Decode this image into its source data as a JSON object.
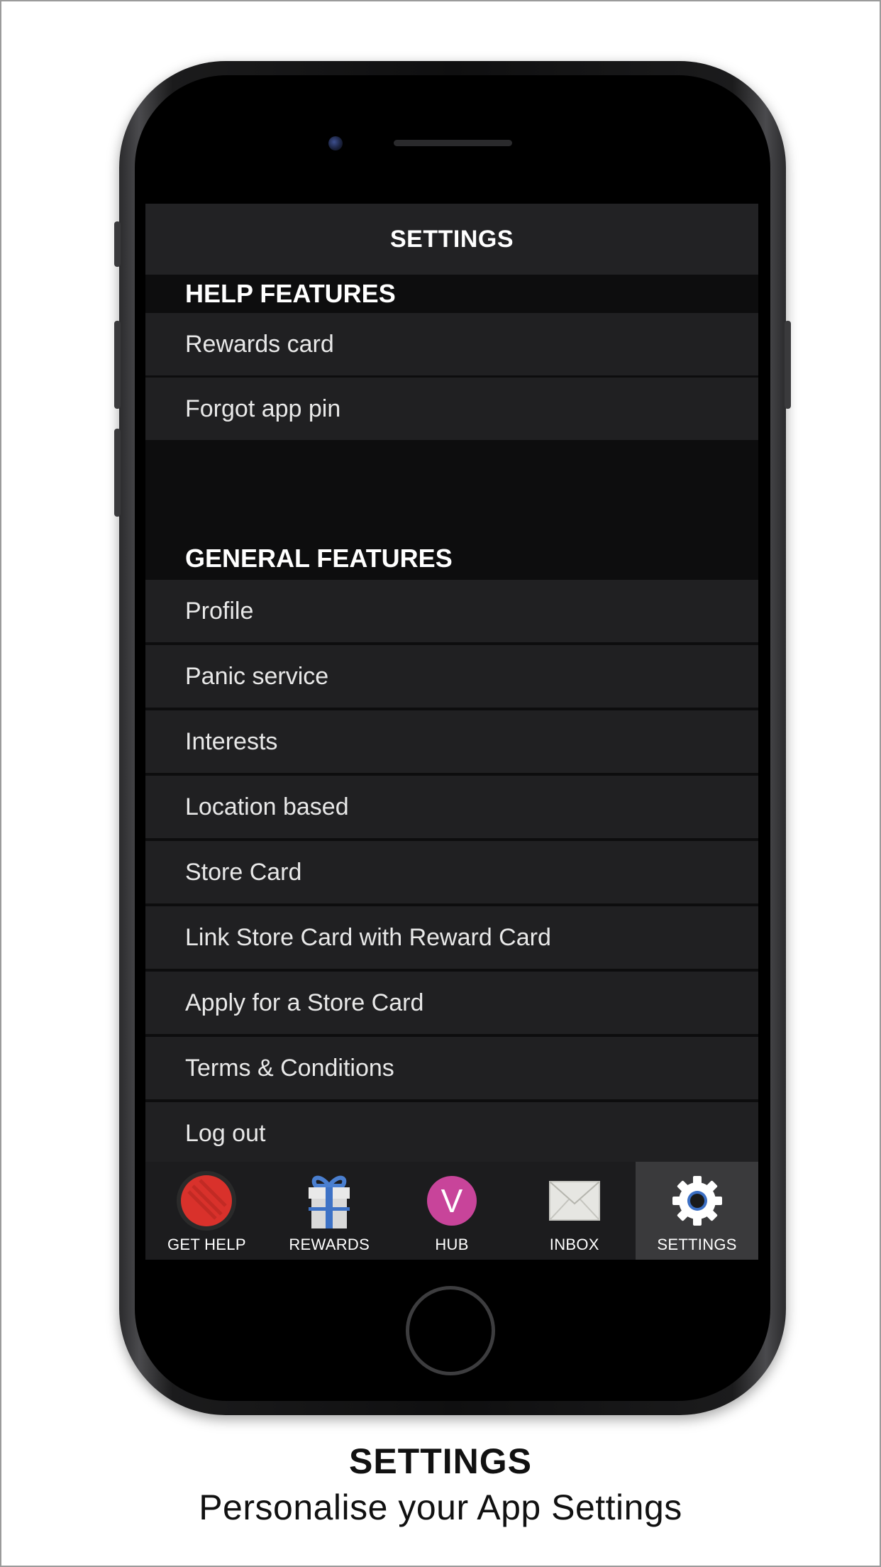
{
  "header": {
    "title": "SETTINGS"
  },
  "help_features": {
    "heading": "HELP FEATURES",
    "items": [
      {
        "label": "Rewards card"
      },
      {
        "label": "Forgot app pin"
      }
    ]
  },
  "general_features": {
    "heading": "GENERAL FEATURES",
    "items": [
      {
        "label": "Profile"
      },
      {
        "label": "Panic service"
      },
      {
        "label": "Interests"
      },
      {
        "label": "Location based"
      },
      {
        "label": "Store Card"
      },
      {
        "label": "Link Store Card with Reward Card"
      },
      {
        "label": "Apply for a Store Card"
      },
      {
        "label": "Terms & Conditions"
      },
      {
        "label": "Log out"
      }
    ]
  },
  "tabbar": {
    "tabs": [
      {
        "label": "GET HELP",
        "icon": "red-circle-icon"
      },
      {
        "label": "REWARDS",
        "icon": "gift-icon"
      },
      {
        "label": "HUB",
        "icon": "v-logo-icon",
        "glyph": "V"
      },
      {
        "label": "INBOX",
        "icon": "envelope-icon"
      },
      {
        "label": "SETTINGS",
        "icon": "gear-icon",
        "active": true
      }
    ]
  },
  "caption": {
    "title": "SETTINGS",
    "subtitle": "Personalise your App Settings"
  },
  "colors": {
    "screen_bg": "#0d0d0e",
    "row_bg": "#202022",
    "active_tab": "#3a3a3c",
    "hub_pink": "#c8449a",
    "get_help_red": "#d9312b"
  }
}
